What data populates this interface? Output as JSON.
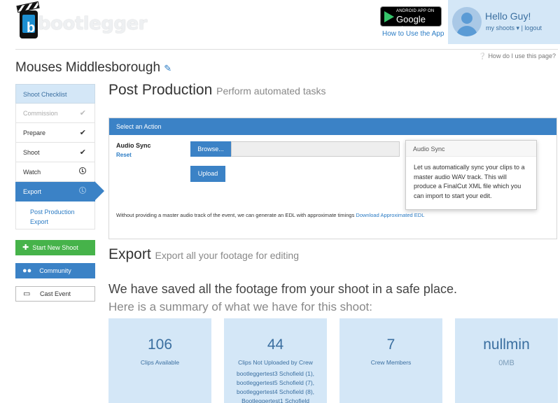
{
  "brand": {
    "name": "bootlegger",
    "logo_letter": "b"
  },
  "header": {
    "play_badge_small": "ANDROID APP ON",
    "play_badge_big": "Google play",
    "how_to_use_app": "How to Use the App",
    "greeting": "Hello Guy!",
    "my_shoots": "my shoots",
    "logout": "logout",
    "help": "How do I use this page?"
  },
  "event": {
    "title": "Mouses Middlesborough"
  },
  "sidebar": {
    "heading": "Shoot Checklist",
    "items": [
      {
        "label": "Commission",
        "state": "done-dim"
      },
      {
        "label": "Prepare",
        "state": "done"
      },
      {
        "label": "Shoot",
        "state": "done"
      },
      {
        "label": "Watch",
        "state": "pending"
      },
      {
        "label": "Export",
        "state": "active"
      }
    ],
    "sub_items": [
      "Post Production",
      "Export"
    ],
    "start_new_shoot": "Start New Shoot",
    "community": "Community",
    "cast_event": "Cast Event"
  },
  "post_production": {
    "title": "Post Production",
    "subtitle": "Perform automated tasks",
    "panel_heading": "Select an Action",
    "audio_sync_label": "Audio Sync",
    "reset": "Reset",
    "browse": "Browse...",
    "upload": "Upload",
    "popover_title": "Audio Sync",
    "popover_body": "Let us automatically sync your clips to a master audio WAV track. This will produce a FinalCut XML file which you can import to start your edit.",
    "edl_note": "Without providing a master audio track of the event, we can generate an EDL with approximate timings",
    "edl_link": "Download Approximated EDL"
  },
  "export": {
    "title": "Export",
    "subtitle": "Export all your footage for editing",
    "saved_line": "We have saved all the footage from your shoot in a safe place.",
    "summary_line": "Here is a summary of what we have for this shoot:",
    "stats": [
      {
        "value": "106",
        "label": "Clips Available"
      },
      {
        "value": "44",
        "label": "Clips Not Uploaded by Crew",
        "list": [
          "bootleggertest3 Schofield (1),",
          "bootleggertest5 Schofield (7),",
          "bootleggertest4 Schofield (8),",
          "Bootleggertest1 Schofield"
        ]
      },
      {
        "value": "7",
        "label": "Crew Members"
      },
      {
        "value": "nullmin",
        "label": "0MB"
      }
    ]
  },
  "colors": {
    "accent": "#3b82c6",
    "green": "#46b34a",
    "light_blue": "#d4e7f7"
  }
}
